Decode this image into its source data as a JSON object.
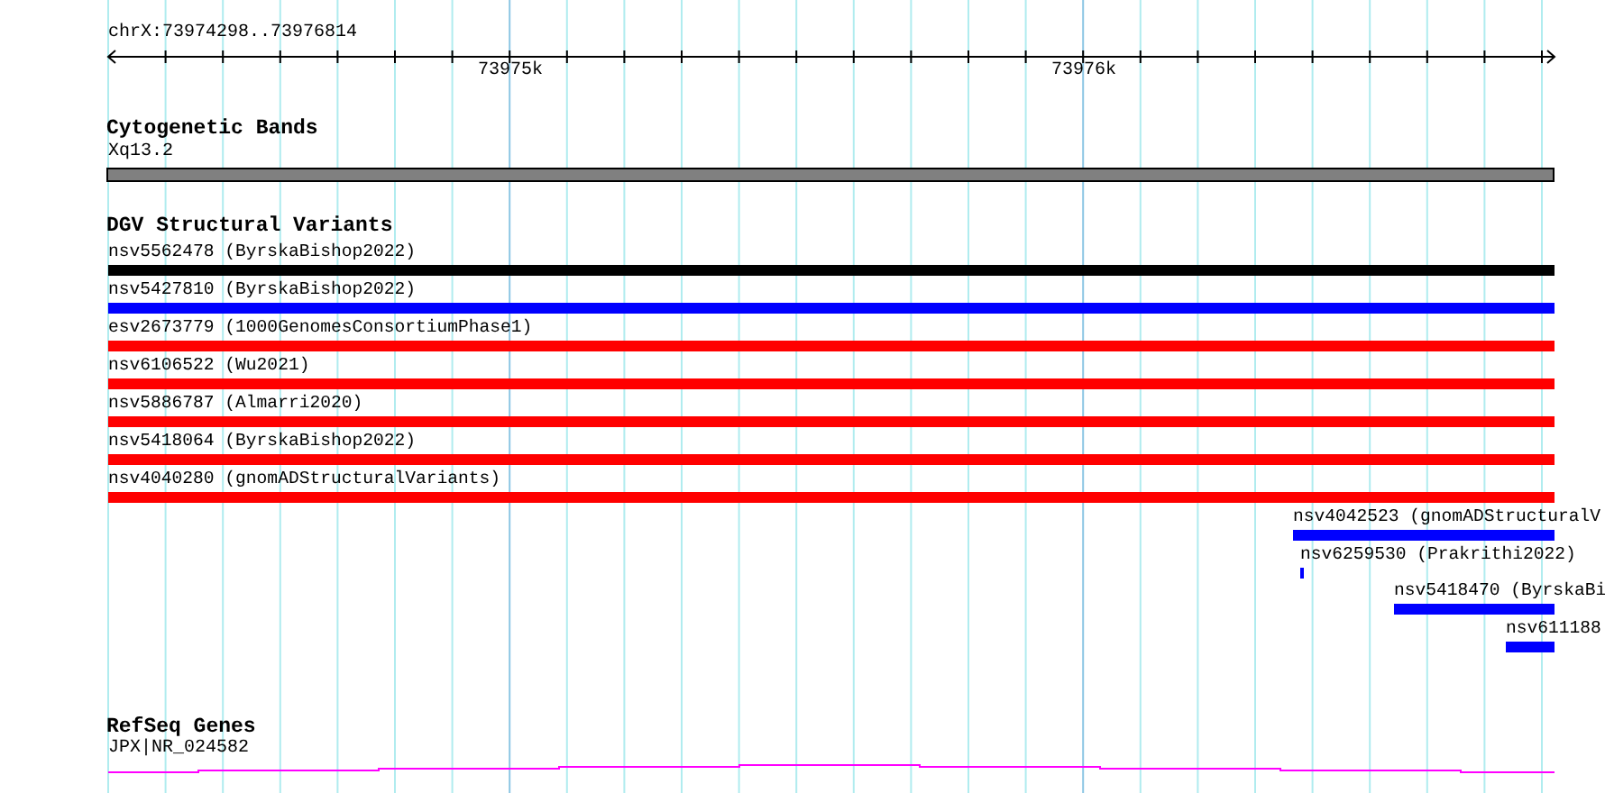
{
  "ruler": {
    "location": "chrX:73974298..73976814",
    "ticks": [
      "73975k",
      "73976k"
    ]
  },
  "tracks": [
    {
      "kind": "bands",
      "title": "Cytogenetic Bands",
      "features": [
        {
          "label": "Xq13.2"
        }
      ]
    },
    {
      "kind": "variants",
      "title": "DGV Structural Variants",
      "features": [
        {
          "label": "nsv5562478 (ByrskaBishop2022)",
          "color": "#000000"
        },
        {
          "label": "nsv5427810 (ByrskaBishop2022)",
          "color": "#0000ff"
        },
        {
          "label": "esv2673779 (1000GenomesConsortiumPhase1)",
          "color": "#ff0000"
        },
        {
          "label": "nsv6106522 (Wu2021)",
          "color": "#ff0000"
        },
        {
          "label": "nsv5886787 (Almarri2020)",
          "color": "#ff0000"
        },
        {
          "label": "nsv5418064 (ByrskaBishop2022)",
          "color": "#ff0000"
        },
        {
          "label": "nsv4040280 (gnomADStructuralVariants)",
          "color": "#ff0000"
        },
        {
          "label": "nsv4042523 (gnomADStructuralV",
          "color": "#0000ff"
        },
        {
          "label": "nsv6259530 (Prakrithi2022)",
          "color": "#0000ff"
        },
        {
          "label": "nsv5418470 (ByrskaBi",
          "color": "#0000ff"
        },
        {
          "label": "nsv611188",
          "color": "#0000ff"
        }
      ]
    },
    {
      "kind": "genes",
      "title": "RefSeq Genes",
      "features": [
        {
          "label": "JPX|NR_024582"
        }
      ]
    }
  ]
}
